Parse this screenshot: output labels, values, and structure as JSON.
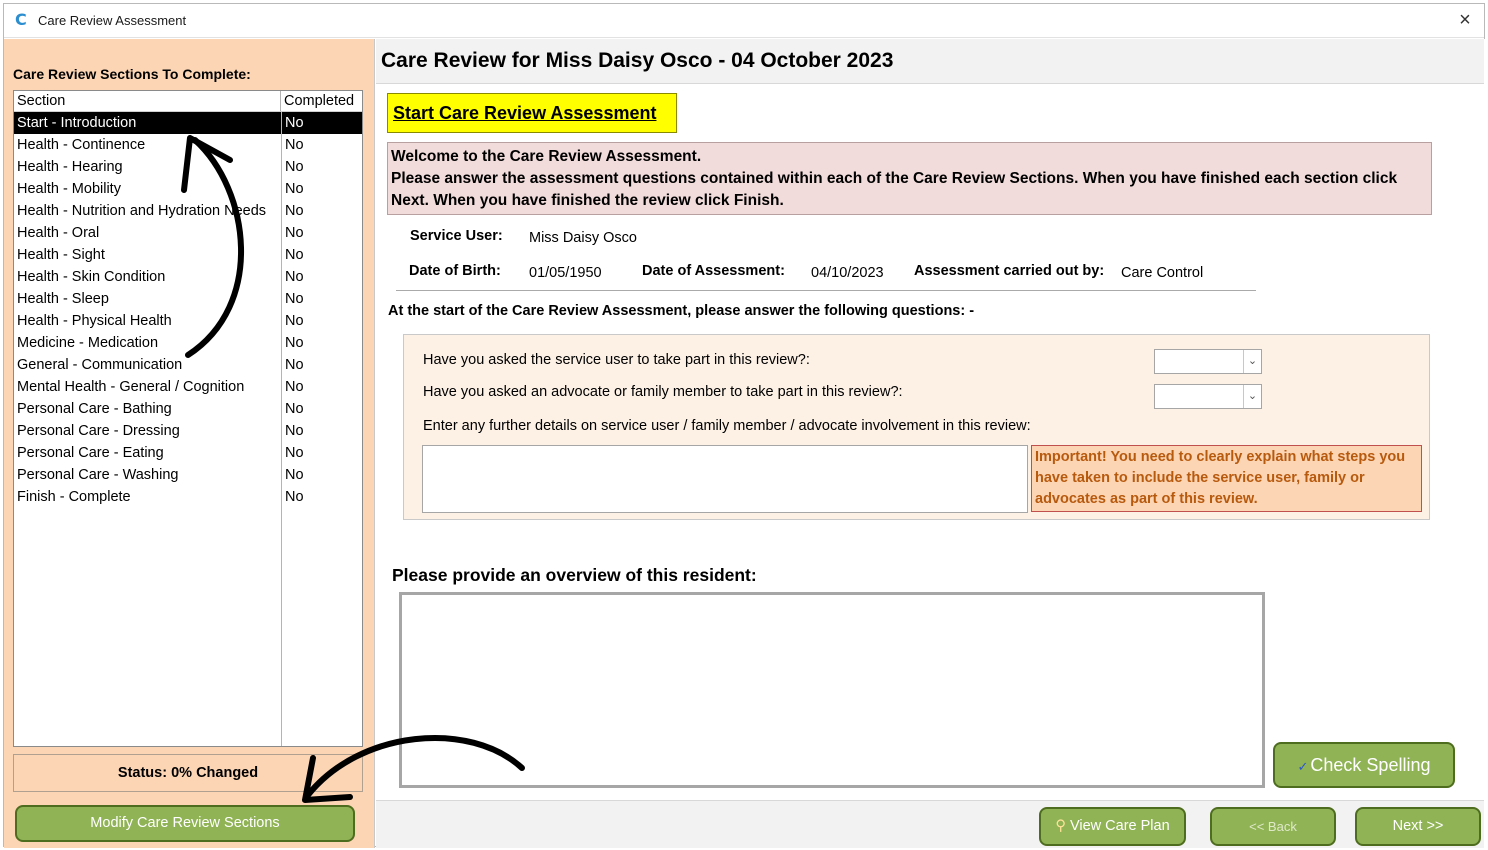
{
  "window": {
    "title": "Care Review Assessment",
    "logo_letter": "C",
    "close_glyph": "×"
  },
  "sidebar": {
    "heading": "Care Review Sections To Complete:",
    "columns": {
      "section": "Section",
      "completed": "Completed"
    },
    "rows": [
      {
        "section": "Start - Introduction",
        "completed": "No"
      },
      {
        "section": "Health - Continence",
        "completed": "No"
      },
      {
        "section": "Health - Hearing",
        "completed": "No"
      },
      {
        "section": "Health - Mobility",
        "completed": "No"
      },
      {
        "section": "Health - Nutrition and Hydration Needs",
        "completed": "No"
      },
      {
        "section": "Health - Oral",
        "completed": "No"
      },
      {
        "section": "Health - Sight",
        "completed": "No"
      },
      {
        "section": "Health - Skin Condition",
        "completed": "No"
      },
      {
        "section": "Health - Sleep",
        "completed": "No"
      },
      {
        "section": "Health - Physical Health",
        "completed": "No"
      },
      {
        "section": "Medicine - Medication",
        "completed": "No"
      },
      {
        "section": "General - Communication",
        "completed": "No"
      },
      {
        "section": "Mental Health - General / Cognition",
        "completed": "No"
      },
      {
        "section": "Personal Care - Bathing",
        "completed": "No"
      },
      {
        "section": "Personal Care - Dressing",
        "completed": "No"
      },
      {
        "section": "Personal Care - Eating",
        "completed": "No"
      },
      {
        "section": "Personal Care - Washing",
        "completed": "No"
      },
      {
        "section": "Finish - Complete",
        "completed": "No"
      }
    ],
    "status": "Status: 0% Changed",
    "modify_button": "Modify Care Review Sections"
  },
  "main": {
    "title": "Care Review for Miss Daisy Osco - 04 October 2023",
    "start_heading": "Start Care Review Assessment",
    "welcome": {
      "line1": "Welcome to the Care Review Assessment.",
      "line2": "Please answer the assessment questions contained within each of the Care Review Sections.  When you have finished each section click Next.  When you have finished the review click Finish."
    },
    "info": {
      "service_user_label": "Service User:",
      "service_user_value": "Miss Daisy Osco",
      "dob_label": "Date of Birth:",
      "dob_value": "01/05/1950",
      "doa_label": "Date of Assessment:",
      "doa_value": "04/10/2023",
      "carried_out_label": "Assessment carried out by:",
      "carried_out_value": "Care Control"
    },
    "questions_intro": "At the start of the Care Review Assessment, please answer the following questions: -",
    "q1": {
      "label": "Have you asked the service user to take part in this review?:",
      "value": ""
    },
    "q2": {
      "label": "Have you asked an advocate or family member to take part in this review?:",
      "value": ""
    },
    "q3": {
      "label": "Enter any further details on service user / family member / advocate involvement  in this review:",
      "value": ""
    },
    "important_note": "Important!  You need to clearly explain what steps you have taken to include the service user, family or advocates as part of this review.",
    "overview_label": "Please provide an overview of this resident:",
    "overview_value": "",
    "buttons": {
      "check_spelling": "Check Spelling",
      "view_care_plan": "View Care Plan",
      "back": "<< Back",
      "next": "Next >>"
    }
  },
  "colors": {
    "sidebar_bg": "#fcd5b5",
    "button_green": "#8fb355",
    "button_border": "#4f6d1f",
    "highlight_yellow": "#ffff00",
    "welcome_bg": "#f2dcdb",
    "important_text": "#b85a0e",
    "selected_row": "#000000"
  },
  "icons": {
    "chevron": "chevron-down-icon",
    "magnifier": "magnifier-icon",
    "spellcheck": "spellcheck-icon"
  }
}
